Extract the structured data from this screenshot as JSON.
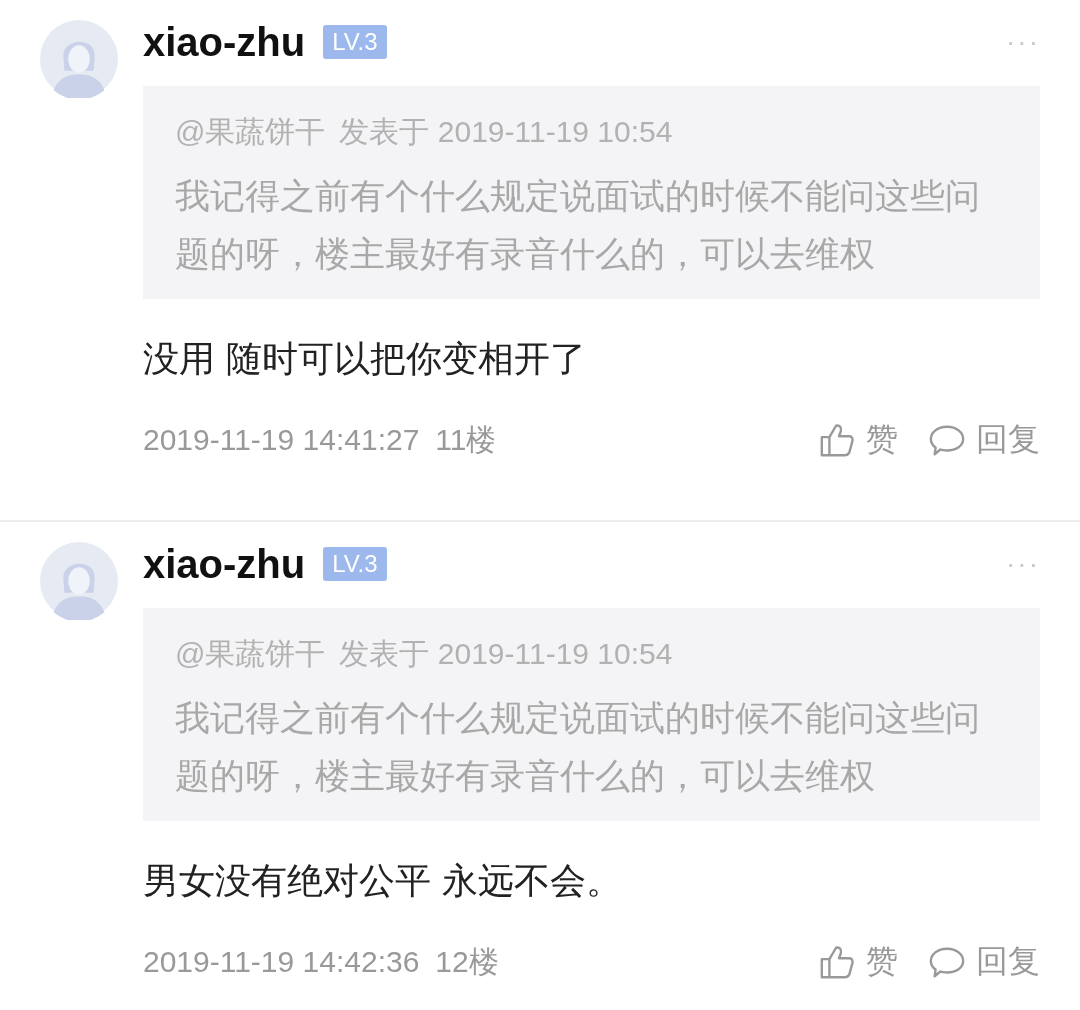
{
  "comments": [
    {
      "user": "xiao-zhu",
      "level_badge": "LV.3",
      "more": "···",
      "quote": {
        "author": "@果蔬饼干",
        "meta": "发表于 2019-11-19 10:54",
        "text": "我记得之前有个什么规定说面试的时候不能问这些问题的呀，楼主最好有录音什么的，可以去维权"
      },
      "body": "没用 随时可以把你变相开了",
      "time": "2019-11-19 14:41:27",
      "floor": "11楼",
      "like": "赞",
      "reply": "回复"
    },
    {
      "user": "xiao-zhu",
      "level_badge": "LV.3",
      "more": "···",
      "quote": {
        "author": "@果蔬饼干",
        "meta": "发表于 2019-11-19 10:54",
        "text": "我记得之前有个什么规定说面试的时候不能问这些问题的呀，楼主最好有录音什么的，可以去维权"
      },
      "body": "男女没有绝对公平  永远不会。",
      "time": "2019-11-19 14:42:36",
      "floor": "12楼",
      "like": "赞",
      "reply": "回复"
    }
  ]
}
